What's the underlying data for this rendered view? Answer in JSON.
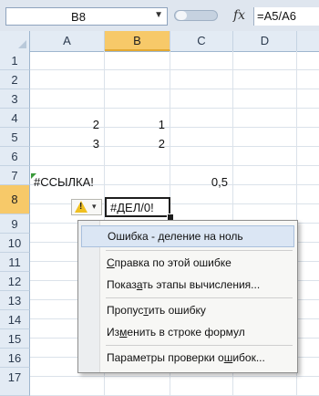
{
  "formula_bar": {
    "name_box": "B8",
    "fx_label": "fx",
    "formula": "=A5/A6"
  },
  "columns": [
    "A",
    "B",
    "C",
    "D"
  ],
  "active_column": "B",
  "rows": [
    "1",
    "2",
    "3",
    "4",
    "5",
    "6",
    "7",
    "8",
    "9",
    "10",
    "11",
    "12",
    "13",
    "14",
    "15",
    "16",
    "17"
  ],
  "active_row": "8",
  "cells": {
    "A4": "2",
    "B4": "1",
    "A5": "3",
    "B5": "2",
    "A7": "#ССЫЛКА!",
    "C7": "0,5",
    "B8": "#ДЕЛ/0!"
  },
  "smart_tag": {
    "icon": "warning-icon",
    "arrow": "▾"
  },
  "error_menu": {
    "title_item": "Ошибка  - деление на ноль",
    "items": [
      {
        "pre": "",
        "ul": "С",
        "post": "правка по этой ошибке"
      },
      {
        "pre": "Показ",
        "ul": "а",
        "post": "ть этапы вычисления..."
      },
      {
        "pre": "Пропус",
        "ul": "т",
        "post": "ить ошибку"
      },
      {
        "pre": "Из",
        "ul": "м",
        "post": "енить в строке формул"
      },
      {
        "pre": "Параметры проверки о",
        "ul": "ш",
        "post": "ибок..."
      }
    ]
  }
}
